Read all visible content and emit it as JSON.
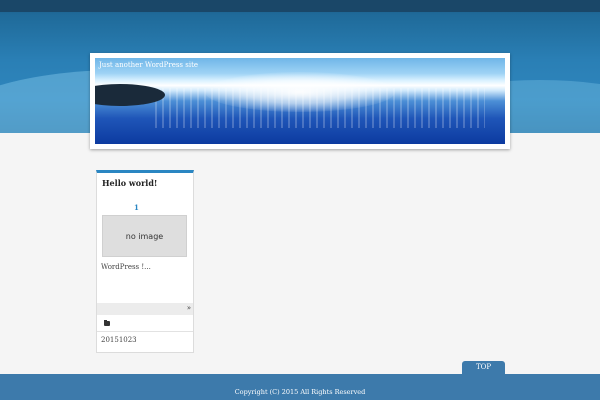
{
  "header": {
    "tagline": "Just another WordPress site"
  },
  "post": {
    "title": "Hello world!",
    "page_number": "1",
    "no_image_label": "no image",
    "excerpt": "WordPress  !...",
    "more_arrow": "»",
    "date": "20151023"
  },
  "footer": {
    "top_label": "TOP",
    "copyright": "Copyright (C) 2015        All Rights Reserved"
  }
}
